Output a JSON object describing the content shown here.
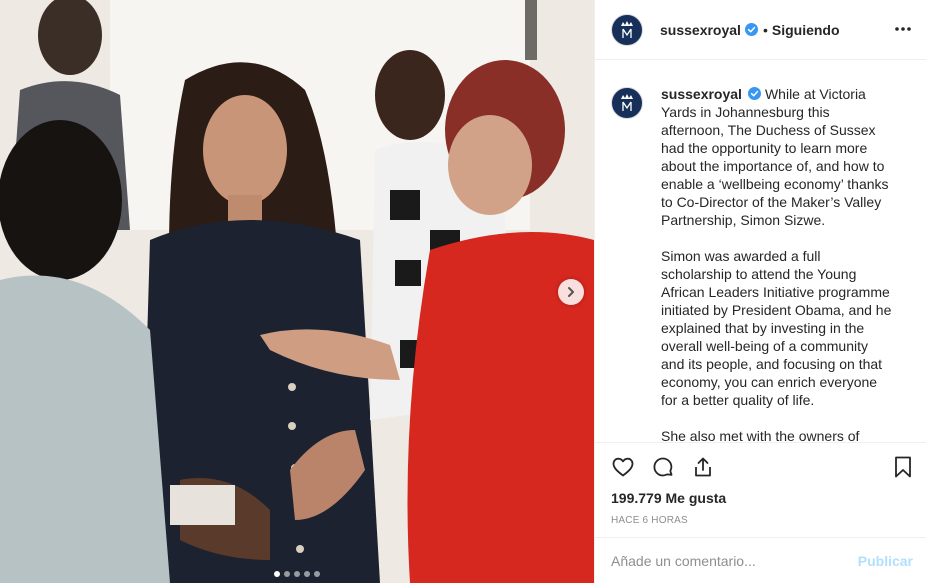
{
  "post": {
    "username": "sussexroyal",
    "separator": "•",
    "follow_status": "Siguiendo",
    "caption_paragraphs": [
      "While at Victoria Yards in Johannesburg this afternoon, The Duchess of Sussex had the opportunity to learn more about the importance of, and how to enable a ‘wellbeing economy’ thanks to Co-Director of the Maker’s Valley Partnership, Simon Sizwe.",
      "Simon was awarded a full scholarship to attend the Young African Leaders Initiative programme initiated by President Obama, and he explained that by investing in the overall well-being of a community and its people, and focusing on that economy, you can enrich everyone for a better quality of life.",
      "She also met with the owners of"
    ],
    "likes": "199.779 Me gusta",
    "timestamp": "HACE 6 HORAS",
    "comment_placeholder": "Añade un comentario...",
    "publish_label": "Publicar"
  },
  "carousel": {
    "total": 5,
    "active_index": 0
  },
  "icons": {
    "verified": "verified-badge-icon",
    "more": "more-options-icon",
    "like": "heart-icon",
    "comment": "comment-bubble-icon",
    "share": "share-icon",
    "save": "bookmark-icon",
    "next": "chevron-right-icon"
  },
  "colors": {
    "verified_blue": "#3897f0",
    "avatar_navy": "#17305a",
    "publish_disabled": "#b2dffc",
    "secondary_text": "#8e8e8e"
  }
}
